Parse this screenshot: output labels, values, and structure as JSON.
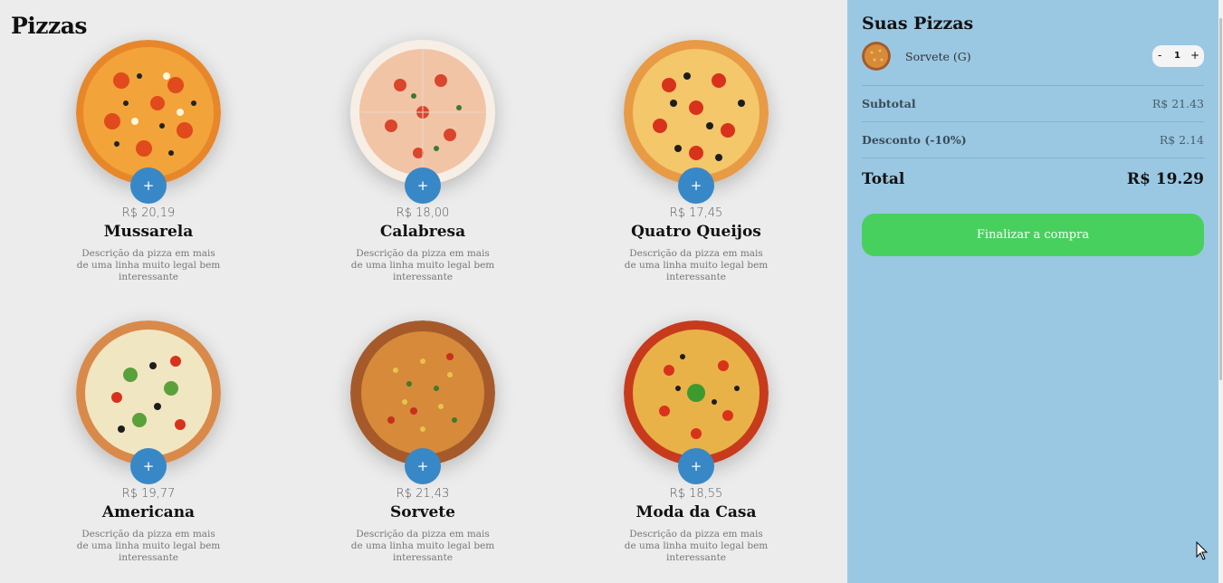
{
  "page": {
    "title": "Pizzas"
  },
  "pizzas": [
    {
      "name": "Mussarela",
      "price": "R$ 20,19",
      "desc": "Descrição da pizza em mais de uma linha muito legal bem interessante",
      "add": "+"
    },
    {
      "name": "Calabresa",
      "price": "R$ 18,00",
      "desc": "Descrição da pizza em mais de uma linha muito legal bem interessante",
      "add": "+"
    },
    {
      "name": "Quatro Queijos",
      "price": "R$ 17,45",
      "desc": "Descrição da pizza em mais de uma linha muito legal bem interessante",
      "add": "+"
    },
    {
      "name": "Americana",
      "price": "R$ 19,77",
      "desc": "Descrição da pizza em mais de uma linha muito legal bem interessante",
      "add": "+"
    },
    {
      "name": "Sorvete",
      "price": "R$ 21,43",
      "desc": "Descrição da pizza em mais de uma linha muito legal bem interessante",
      "add": "+"
    },
    {
      "name": "Moda da Casa",
      "price": "R$ 18,55",
      "desc": "Descrição da pizza em mais de uma linha muito legal bem interessante",
      "add": "+"
    }
  ],
  "cart": {
    "title": "Suas Pizzas",
    "items": [
      {
        "name": "Sorvete (G)",
        "qty_minus": "-",
        "qty": "1",
        "qty_plus": "+"
      }
    ],
    "subtotal_label": "Subtotal",
    "subtotal_value": "R$ 21.43",
    "discount_label": "Desconto (-10%)",
    "discount_value": "R$ 2.14",
    "total_label": "Total",
    "total_value": "R$ 19.29",
    "checkout_label": "Finalizar a compra"
  },
  "colors": {
    "main_bg": "#ececec",
    "sidebar_bg": "#9ac8e3",
    "accent_blue": "#3888c7",
    "checkout_green": "#48d05f"
  }
}
